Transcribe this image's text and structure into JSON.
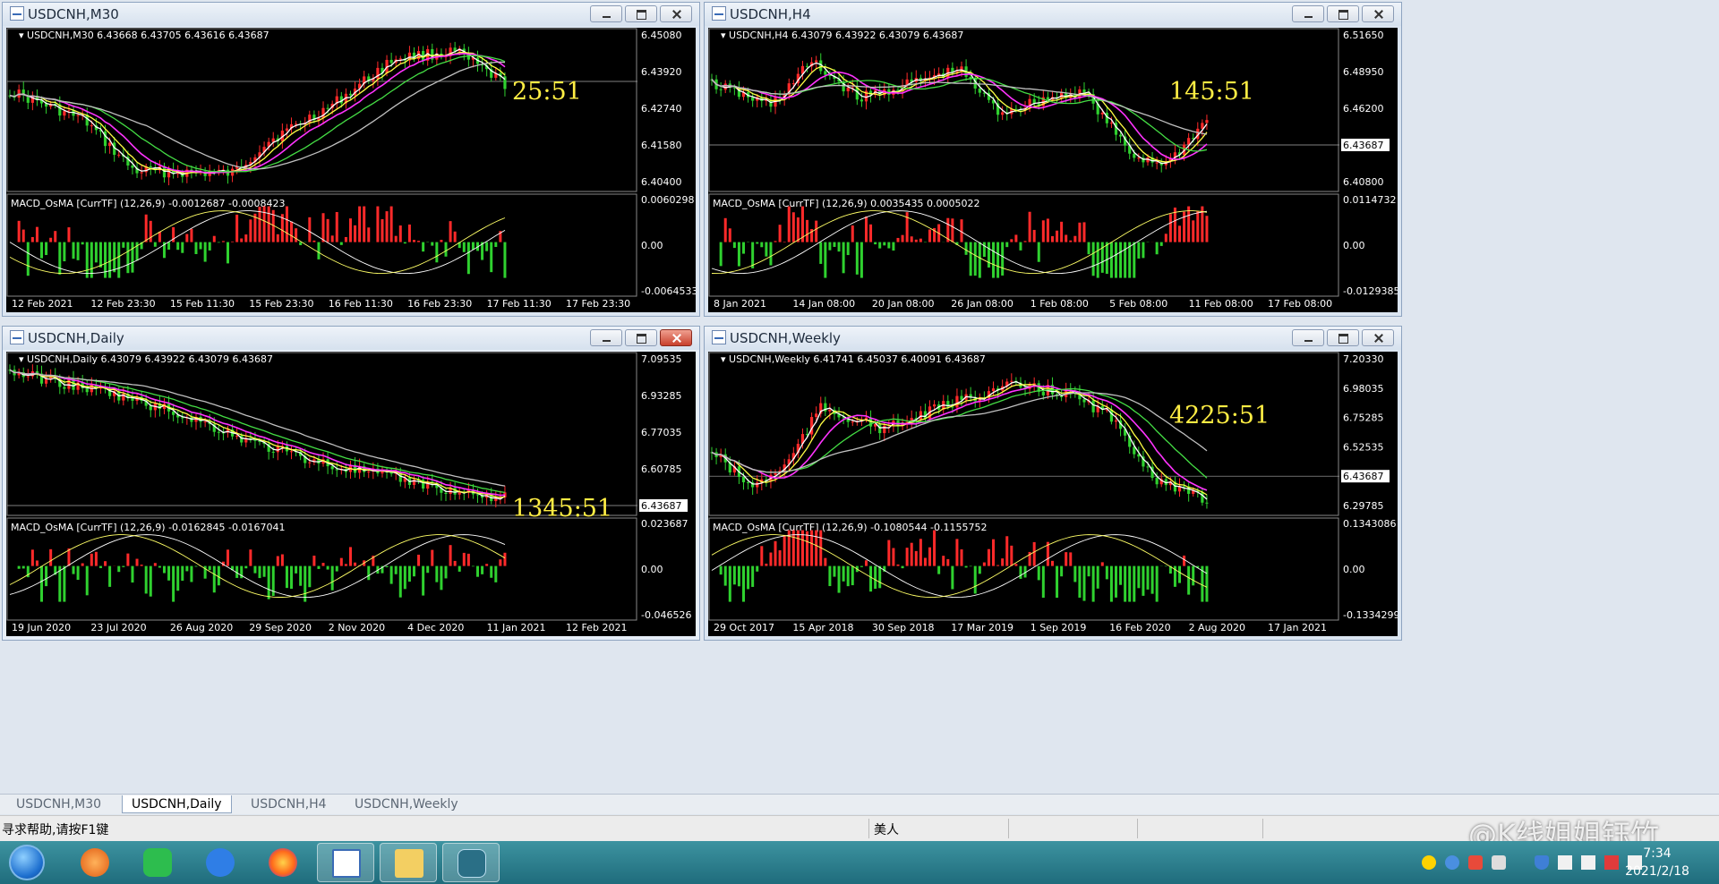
{
  "windows": [
    {
      "title": "USDCNH,M30",
      "header": "USDCNH,M30  6.43668 6.43705 6.43616 6.43687",
      "price_labels": [
        "6.45080",
        "6.43920",
        "6.42740",
        "6.41580",
        "6.40400"
      ],
      "current_price": "6.43687",
      "timer": "25:51",
      "macd_header": "MACD_OsMA [CurrTF] (12,26,9) -0.0012687 -0.0008423",
      "macd_labels": [
        "0.0060298",
        "0.00",
        "-0.0064533"
      ],
      "time_labels": [
        "12 Feb 2021",
        "12 Feb 23:30",
        "15 Feb 11:30",
        "15 Feb 23:30",
        "16 Feb 11:30",
        "16 Feb 23:30",
        "17 Feb 11:30",
        "17 Feb 23:30"
      ],
      "chart_data": {
        "type": "candlestick",
        "trend": "down-then-up",
        "ylim": [
          6.4,
          6.452
        ],
        "last": 6.43687,
        "macd_range": [
          -0.0064533,
          0.0060298
        ]
      }
    },
    {
      "title": "USDCNH,H4",
      "header": "USDCNH,H4  6.43079 6.43922 6.43079 6.43687",
      "price_labels": [
        "6.51650",
        "6.48950",
        "6.46200",
        "6.43687",
        "6.40800"
      ],
      "current_price": "6.43687",
      "timer": "145:51",
      "macd_header": "MACD_OsMA [CurrTF] (12,26,9) 0.0035435 0.0005022",
      "macd_labels": [
        "0.0114732",
        "0.00",
        "-0.0129385"
      ],
      "time_labels": [
        "8 Jan 2021",
        "14 Jan 08:00",
        "20 Jan 08:00",
        "26 Jan 08:00",
        "1 Feb 08:00",
        "5 Feb 08:00",
        "11 Feb 08:00",
        "17 Feb 08:00"
      ],
      "chart_data": {
        "type": "candlestick",
        "trend": "range-then-down",
        "ylim": [
          6.395,
          6.52
        ],
        "last": 6.43687,
        "macd_range": [
          -0.0129385,
          0.0114732
        ]
      }
    },
    {
      "title": "USDCNH,Daily",
      "header": "USDCNH,Daily  6.43079 6.43922 6.43079 6.43687",
      "price_labels": [
        "7.09535",
        "6.93285",
        "6.77035",
        "6.60785",
        "6.43687"
      ],
      "current_price": "6.43687",
      "timer": "1345:51",
      "macd_header": "MACD_OsMA [CurrTF] (12,26,9) -0.0162845 -0.0167041",
      "macd_labels": [
        "0.023687",
        "0.00",
        "-0.046526"
      ],
      "time_labels": [
        "19 Jun 2020",
        "23 Jul 2020",
        "26 Aug 2020",
        "29 Sep 2020",
        "2 Nov 2020",
        "4 Dec 2020",
        "11 Jan 2021",
        "12 Feb 2021"
      ],
      "chart_data": {
        "type": "candlestick",
        "trend": "down",
        "ylim": [
          6.42,
          7.11
        ],
        "last": 6.43687,
        "macd_range": [
          -0.046526,
          0.023687
        ]
      }
    },
    {
      "title": "USDCNH,Weekly",
      "header": "USDCNH,Weekly  6.41741 6.45037 6.40091 6.43687",
      "price_labels": [
        "7.20330",
        "6.98035",
        "6.75285",
        "6.52535",
        "6.43687",
        "6.29785"
      ],
      "current_price": "6.43687",
      "timer": "4225:51",
      "macd_header": "MACD_OsMA [CurrTF] (12,26,9) -0.1080544 -0.1155752",
      "macd_labels": [
        "0.1343086",
        "0.00",
        "-0.1334299"
      ],
      "time_labels": [
        "29 Oct 2017",
        "15 Apr 2018",
        "30 Sep 2018",
        "17 Mar 2019",
        "1 Sep 2019",
        "16 Feb 2020",
        "2 Aug 2020",
        "17 Jan 2021"
      ],
      "chart_data": {
        "type": "candlestick",
        "trend": "up-then-down",
        "ylim": [
          6.26,
          7.22
        ],
        "last": 6.43687,
        "macd_range": [
          -0.1334299,
          0.1343086
        ]
      }
    }
  ],
  "tabs": [
    "USDCNH,M30",
    "USDCNH,Daily",
    "USDCNH,H4",
    "USDCNH,Weekly"
  ],
  "active_tab": "USDCNH,Daily",
  "status": {
    "help": "寻求帮助,请按F1键",
    "user": "美人"
  },
  "taskbar": {
    "time": "7:34",
    "date": "2021/2/18"
  },
  "watermark": "@K线姐姐钰竹",
  "colors": {
    "bull": "#ff2a2a",
    "bear": "#2fd12f",
    "ma_white": "#ffffff",
    "ma_yellow": "#ffff44",
    "ma_magenta": "#ff33ff",
    "ma_green": "#44dd44",
    "ma_gray": "#c0c0c0",
    "timer": "#ffee44"
  }
}
